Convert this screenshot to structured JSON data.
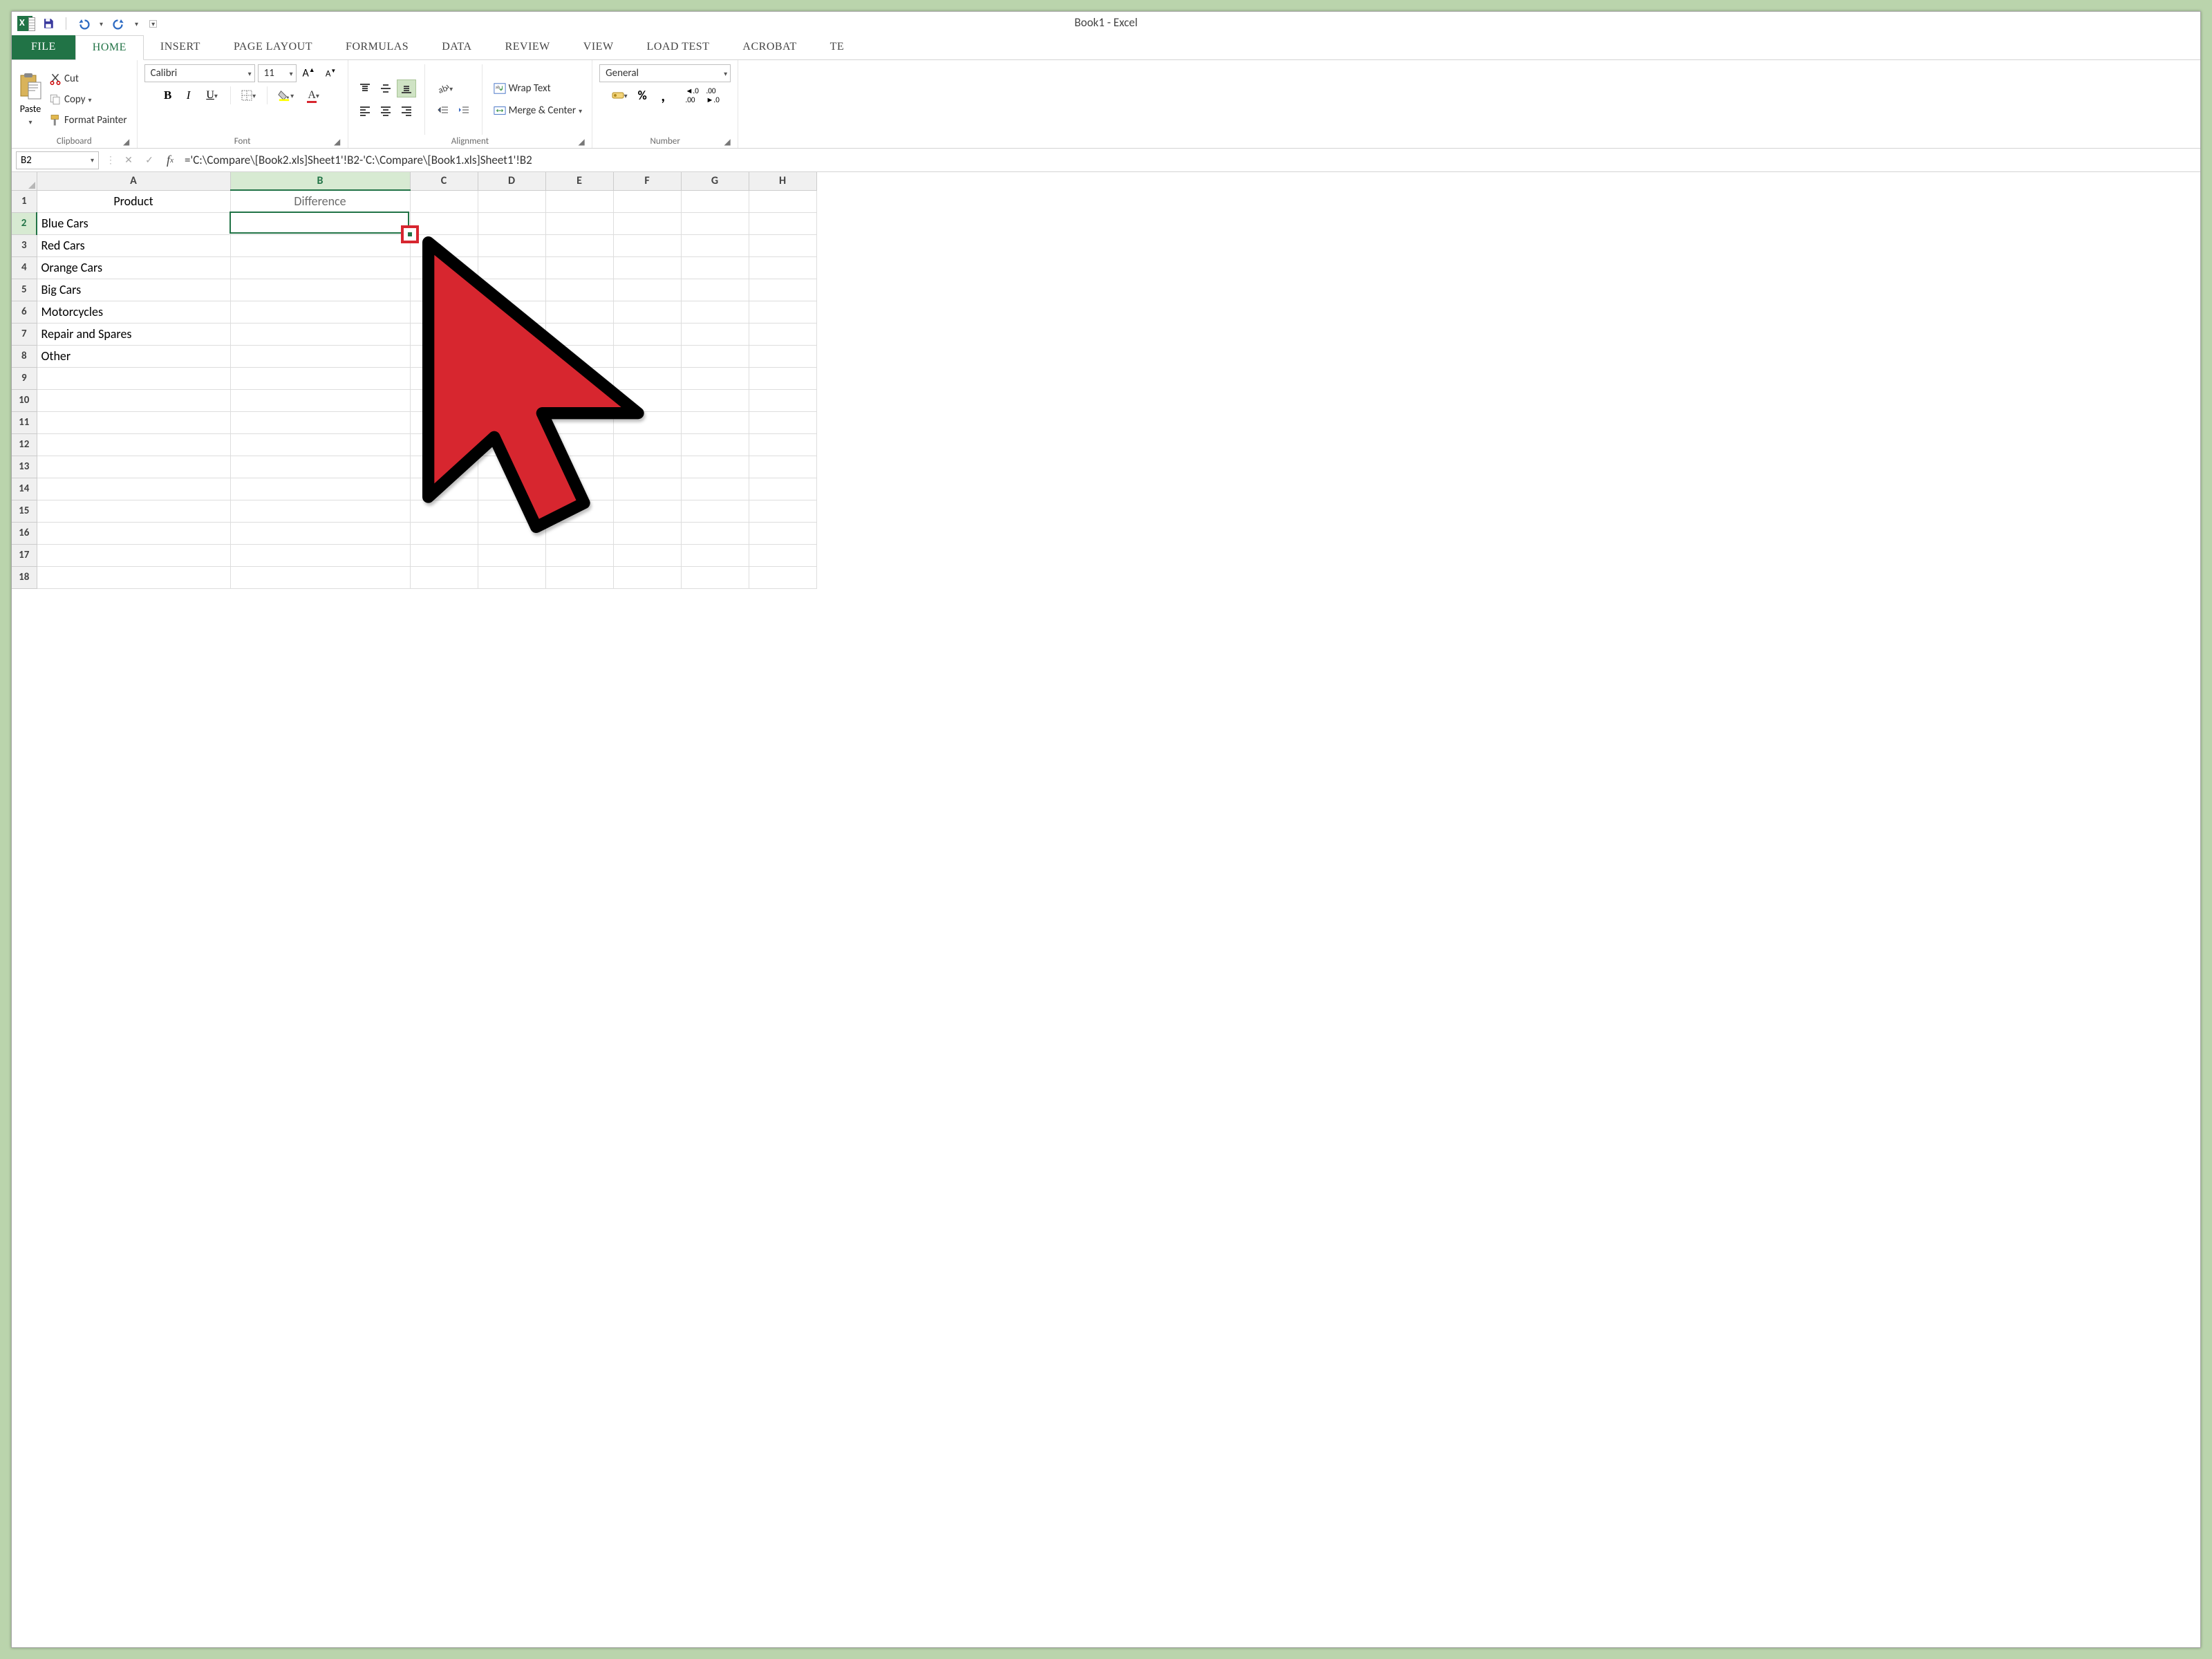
{
  "title": "Book1 - Excel",
  "qat": {
    "save": "Save",
    "undo": "Undo",
    "redo": "Redo"
  },
  "tabs": [
    "FILE",
    "HOME",
    "INSERT",
    "PAGE LAYOUT",
    "FORMULAS",
    "DATA",
    "REVIEW",
    "VIEW",
    "LOAD TEST",
    "ACROBAT",
    "TE"
  ],
  "activeTab": "HOME",
  "ribbon": {
    "clipboard": {
      "paste": "Paste",
      "cut": "Cut",
      "copy": "Copy",
      "formatPainter": "Format Painter",
      "group": "Clipboard"
    },
    "font": {
      "font": "Calibri",
      "size": "11",
      "bold": "B",
      "italic": "I",
      "underline": "U",
      "group": "Font"
    },
    "alignment": {
      "wrap": "Wrap Text",
      "merge": "Merge & Center",
      "group": "Alignment"
    },
    "number": {
      "format": "General",
      "group": "Number"
    }
  },
  "nameBox": "B2",
  "formula": "='C:\\Compare\\[Book2.xls]Sheet1'!B2-'C:\\Compare\\[Book1.xls]Sheet1'!B2",
  "columns": [
    "A",
    "B",
    "C",
    "D",
    "E",
    "F",
    "G",
    "H"
  ],
  "colWidths": {
    "A": 280,
    "B": 260,
    "default": 98
  },
  "rowsVisible": 18,
  "activeCell": {
    "row": 2,
    "col": "B"
  },
  "data": {
    "1": {
      "A": "Product",
      "B": "Difference"
    },
    "2": {
      "A": "Blue Cars"
    },
    "3": {
      "A": "Red Cars"
    },
    "4": {
      "A": "Orange Cars"
    },
    "5": {
      "A": "Big Cars"
    },
    "6": {
      "A": "Motorcycles"
    },
    "7": {
      "A": "Repair and Spares"
    },
    "8": {
      "A": "Other"
    }
  },
  "headerRowStyle": {
    "row": 1,
    "center": true,
    "diffColor": "B"
  }
}
